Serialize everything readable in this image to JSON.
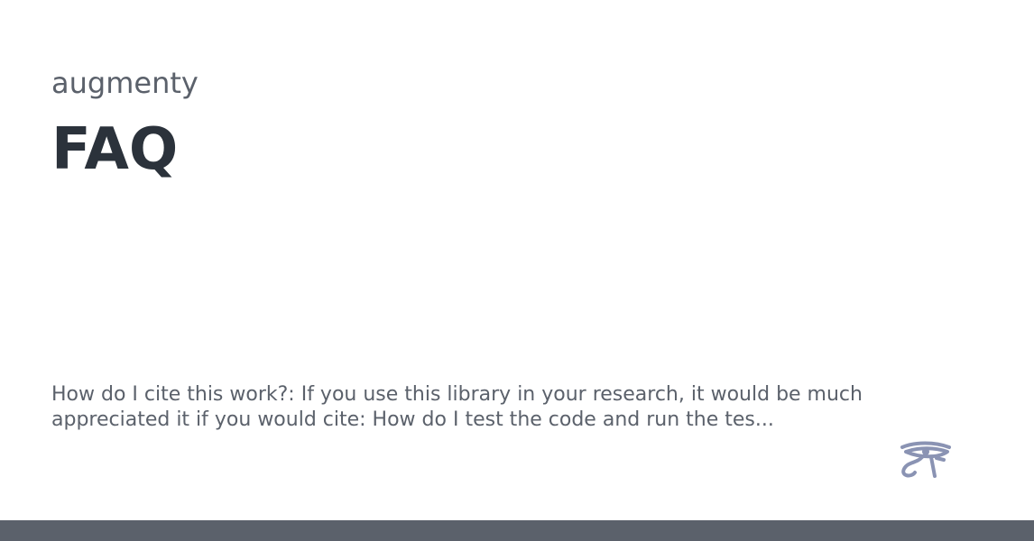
{
  "site": {
    "name": "augmenty"
  },
  "page": {
    "title": "FAQ",
    "description": "How do I cite this work?: If you use this library in your research, it would be much appreciated it if you would cite: How do I test the code and run the tes..."
  },
  "logo": {
    "icon": "eye-of-horus-icon",
    "color": "#8a93b3"
  },
  "footer": {
    "color": "#5b616b"
  }
}
